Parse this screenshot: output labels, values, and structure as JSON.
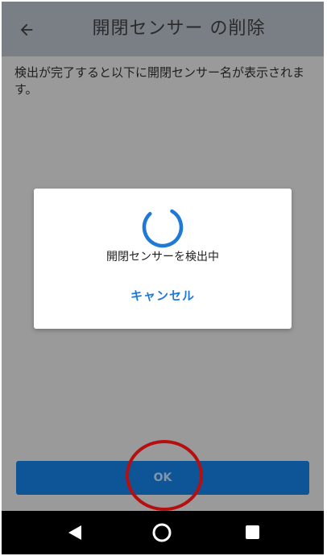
{
  "appbar": {
    "title": "開閉センサー の削除",
    "back_icon": "arrow-left-icon"
  },
  "description": "検出が完了すると以下に開閉センサー名が表示されます。",
  "dialog": {
    "message": "開閉センサーを検出中",
    "cancel_label": "キャンセル",
    "spinner_icon": "loading-spinner-icon"
  },
  "footer": {
    "ok_label": "OK"
  },
  "navbar": {
    "back_icon": "nav-back-triangle-icon",
    "home_icon": "nav-home-circle-icon",
    "recent_icon": "nav-recents-square-icon"
  },
  "colors": {
    "appbar": "#7a7f86",
    "scrim": "#9a9a9a",
    "accent": "#1f7ad6",
    "ok_button": "#0d5597",
    "highlight": "#b50f10"
  }
}
